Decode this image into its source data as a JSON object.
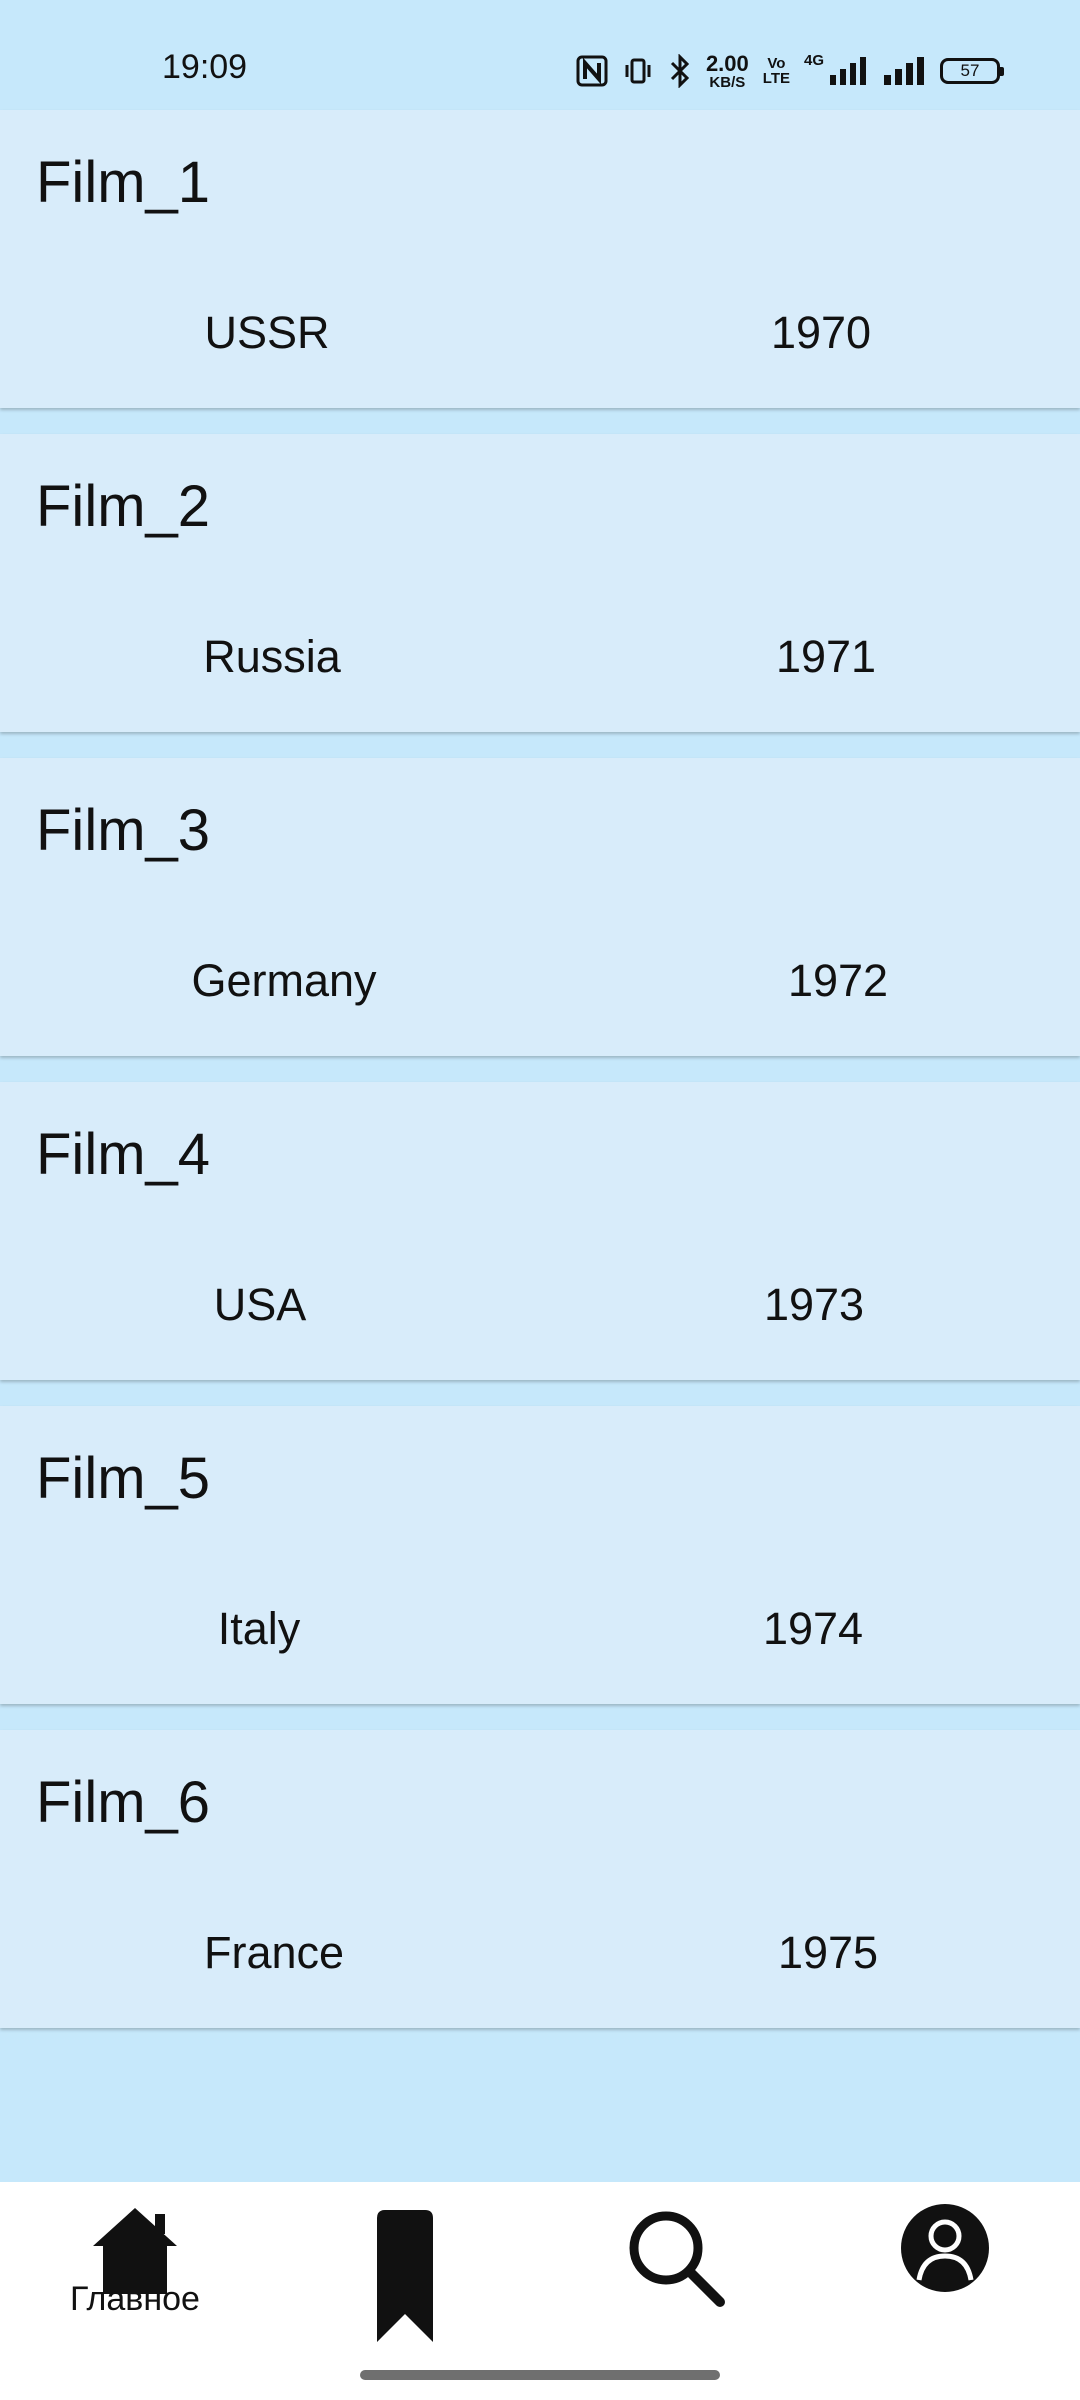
{
  "status_bar": {
    "time": "19:09",
    "net_speed_value": "2.00",
    "net_speed_unit": "KB/S",
    "volte_top": "Vo",
    "volte_bottom": "LTE",
    "network_type": "4G",
    "battery": "57",
    "icons": [
      "nfc-icon",
      "vibrate-icon",
      "bluetooth-icon",
      "signal-icon",
      "signal-icon-2",
      "battery-icon"
    ]
  },
  "films": [
    {
      "title": "Film_1",
      "country": "USSR",
      "year": "1970"
    },
    {
      "title": "Film_2",
      "country": "Russia",
      "year": "1971"
    },
    {
      "title": "Film_3",
      "country": "Germany",
      "year": "1972"
    },
    {
      "title": "Film_4",
      "country": "USA",
      "year": "1973"
    },
    {
      "title": "Film_5",
      "country": "Italy",
      "year": "1974"
    },
    {
      "title": "Film_6",
      "country": "France",
      "year": "1975"
    }
  ],
  "bottom_nav": {
    "items": [
      {
        "icon": "home-icon",
        "label": "Главное",
        "active": true
      },
      {
        "icon": "bookmark-icon",
        "label": ""
      },
      {
        "icon": "search-icon",
        "label": ""
      },
      {
        "icon": "profile-icon",
        "label": ""
      }
    ]
  },
  "colors": {
    "background": "#c6e8fb",
    "card": "#d8ecfa",
    "nav_background": "#ffffff",
    "text": "#111111"
  }
}
